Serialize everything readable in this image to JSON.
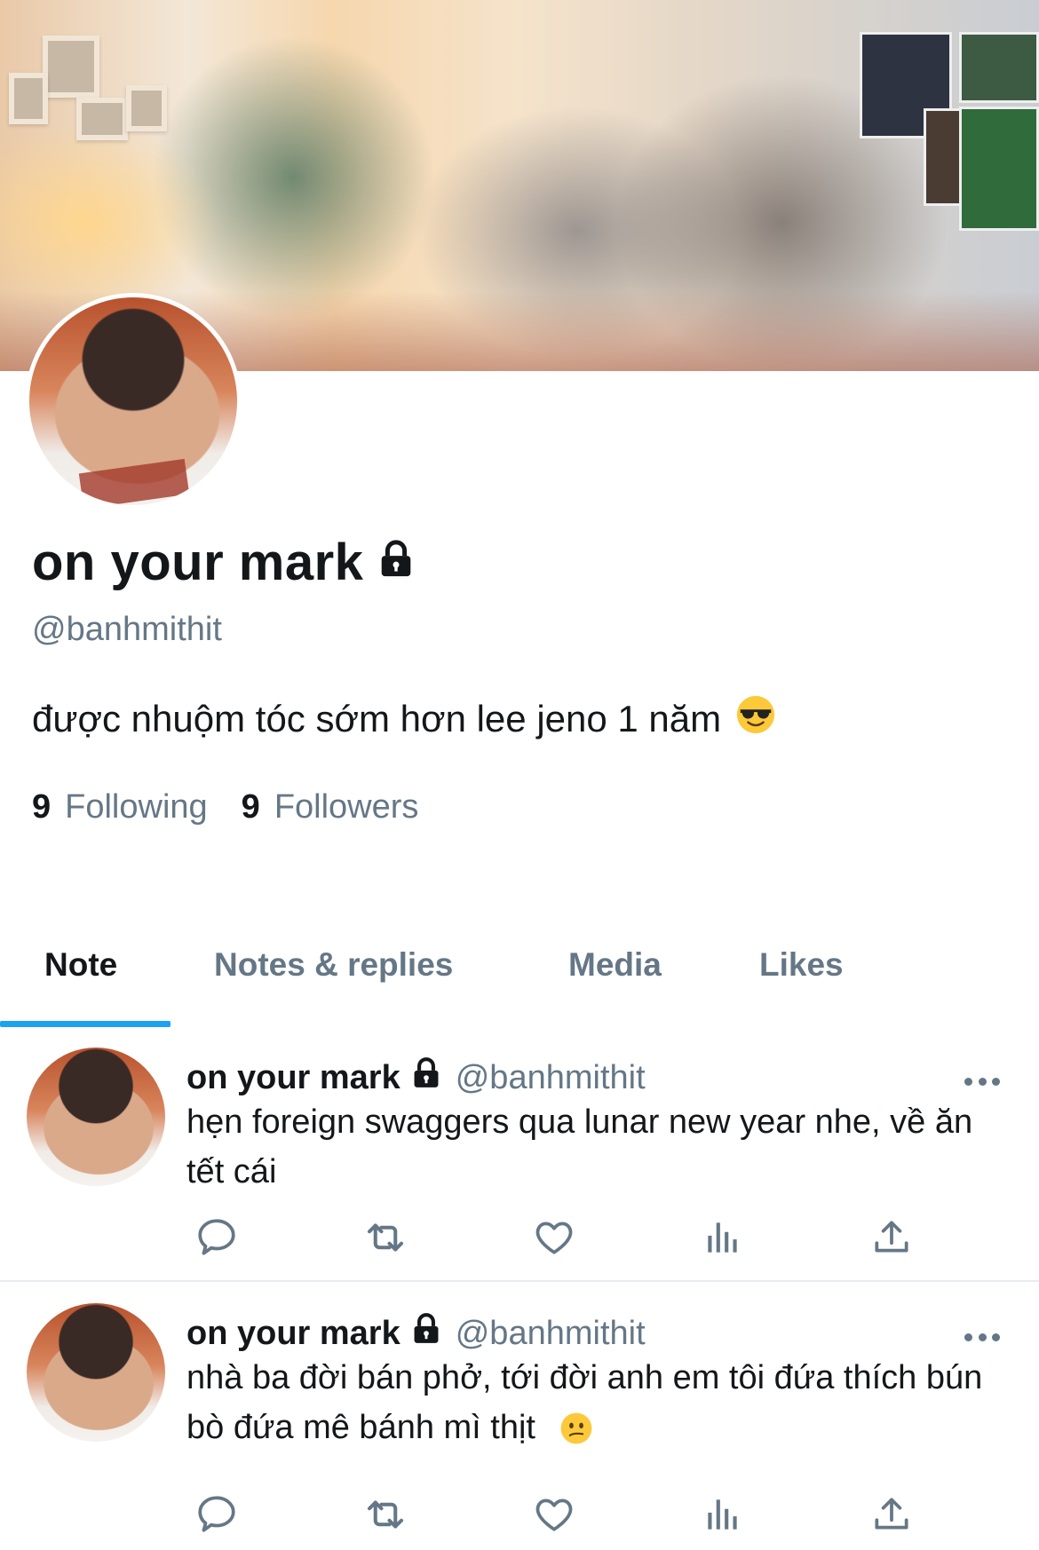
{
  "colors": {
    "accent": "#1da1f2",
    "text_primary": "#14171a",
    "text_secondary": "#657786"
  },
  "profile": {
    "name": "on your mark",
    "handle": "@banhmithit",
    "bio": "được nhuộm tóc sớm hơn lee jeno 1 năm",
    "bio_emoji": "smiling-face-with-sunglasses",
    "protected_icon": "lock-icon",
    "following_count": "9",
    "following_label": "Following",
    "followers_count": "9",
    "followers_label": "Followers"
  },
  "tabs": [
    {
      "label": "Note",
      "active": true
    },
    {
      "label": "Notes & replies",
      "active": false
    },
    {
      "label": "Media",
      "active": false
    },
    {
      "label": "Likes",
      "active": false
    }
  ],
  "posts": [
    {
      "name": "on your mark",
      "handle": "@banhmithit",
      "text": "hẹn foreign swaggers qua lunar new year nhe, về ăn tết cái",
      "emoji": ""
    },
    {
      "name": "on your mark",
      "handle": "@banhmithit",
      "text": "nhà ba đời bán phở, tới đời anh em tôi đứa thích bún bò đứa mê bánh mì thịt",
      "emoji": "confused-face"
    }
  ],
  "action_icons": [
    "reply-icon",
    "retweet-icon",
    "like-icon",
    "analytics-icon",
    "share-icon"
  ]
}
